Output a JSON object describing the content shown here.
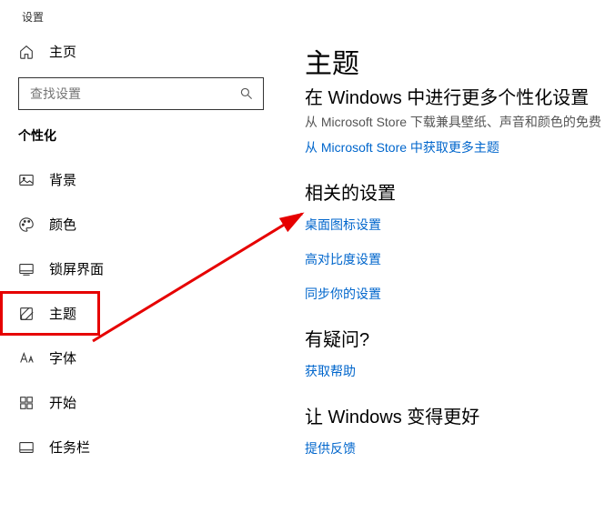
{
  "title": "设置",
  "home": "主页",
  "search_placeholder": "查找设置",
  "category": "个性化",
  "nav": {
    "background": "背景",
    "color": "颜色",
    "lockscreen": "锁屏界面",
    "theme": "主题",
    "fonts": "字体",
    "start": "开始",
    "taskbar": "任务栏"
  },
  "main": {
    "heading": "主题",
    "sub": "在 Windows 中进行更多个性化设置",
    "desc": "从 Microsoft Store 下载兼具壁纸、声音和颜色的免费",
    "store_link": "从 Microsoft Store 中获取更多主题",
    "related_heading": "相关的设置",
    "links": {
      "desktop_icons": "桌面图标设置",
      "high_contrast": "高对比度设置",
      "sync": "同步你的设置"
    },
    "help_heading": "有疑问?",
    "help_link": "获取帮助",
    "feedback_heading": "让 Windows 变得更好",
    "feedback_link": "提供反馈"
  }
}
